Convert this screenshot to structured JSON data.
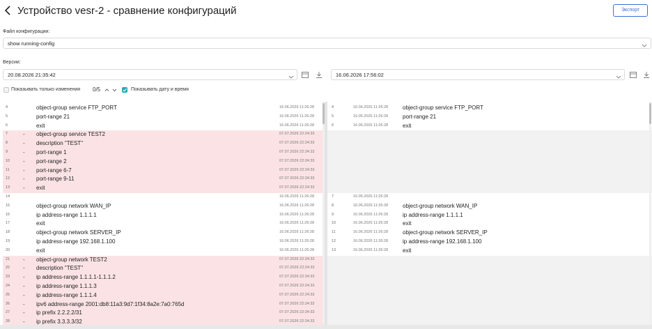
{
  "header": {
    "title": "Устройство vesr-2 - сравнение конфигураций",
    "export_label": "Экспорт"
  },
  "config_file": {
    "label": "Файл конфигурации:",
    "selected": "show running-config"
  },
  "versions": {
    "label": "Версии:",
    "left_selected": "20.08.2026 21:35:42",
    "right_selected": "16.06.2026 17:56:02"
  },
  "options": {
    "only_changes_label": "Показывать только изменения",
    "only_changes_checked": false,
    "changes_counter": "0/5",
    "show_datetime_label": "Показывать дату и время",
    "show_datetime_checked": true
  },
  "colors": {
    "accent": "#2aa6b6",
    "removed_bg": "#fbe3e5",
    "gap_bg": "#f2f2f2",
    "link": "#3b6fd6"
  },
  "left_rows": [
    {
      "ln": "4",
      "mark": "",
      "code": "object-group service FTP_PORT",
      "ts": "16.06.2026 11:26:28",
      "type": "normal"
    },
    {
      "ln": "5",
      "mark": "",
      "code": "port-range 21",
      "ts": "16.06.2026 11:26:28",
      "type": "normal"
    },
    {
      "ln": "6",
      "mark": "",
      "code": "exit",
      "ts": "16.06.2026 11:26:28",
      "type": "normal"
    },
    {
      "ln": "7",
      "mark": "-",
      "code": "object-group service TEST2",
      "ts": "07.07.2026 22:24:33",
      "type": "removed"
    },
    {
      "ln": "8",
      "mark": "-",
      "code": "description \"TEST\"",
      "ts": "07.07.2026 22:24:33",
      "type": "removed"
    },
    {
      "ln": "9",
      "mark": "-",
      "code": "port-range 1",
      "ts": "07.07.2026 22:24:33",
      "type": "removed"
    },
    {
      "ln": "10",
      "mark": "-",
      "code": "port-range 2",
      "ts": "07.07.2026 22:24:33",
      "type": "removed"
    },
    {
      "ln": "11",
      "mark": "-",
      "code": "port-range 6-7",
      "ts": "07.07.2026 22:24:33",
      "type": "removed"
    },
    {
      "ln": "12",
      "mark": "-",
      "code": "port-range 9-11",
      "ts": "07.07.2026 22:24:33",
      "type": "removed"
    },
    {
      "ln": "13",
      "mark": "-",
      "code": "exit",
      "ts": "07.07.2026 22:24:33",
      "type": "removed"
    },
    {
      "ln": "14",
      "mark": "",
      "code": "",
      "ts": "16.06.2026 11:26:28",
      "type": "normal"
    },
    {
      "ln": "15",
      "mark": "",
      "code": "object-group network WAN_IP",
      "ts": "16.06.2026 11:26:28",
      "type": "normal"
    },
    {
      "ln": "16",
      "mark": "",
      "code": "ip address-range 1.1.1.1",
      "ts": "16.06.2026 11:26:28",
      "type": "normal"
    },
    {
      "ln": "17",
      "mark": "",
      "code": "exit",
      "ts": "16.06.2026 11:26:28",
      "type": "normal"
    },
    {
      "ln": "18",
      "mark": "",
      "code": "object-group network SERVER_IP",
      "ts": "16.06.2026 11:26:28",
      "type": "normal"
    },
    {
      "ln": "19",
      "mark": "",
      "code": "ip address-range 192.168.1.100",
      "ts": "16.06.2026 11:26:28",
      "type": "normal"
    },
    {
      "ln": "20",
      "mark": "",
      "code": "exit",
      "ts": "16.06.2026 11:26:28",
      "type": "normal"
    },
    {
      "ln": "21",
      "mark": "-",
      "code": "object-group network TEST2",
      "ts": "07.07.2026 22:24:33",
      "type": "removed"
    },
    {
      "ln": "22",
      "mark": "-",
      "code": "description \"TEST\"",
      "ts": "07.07.2026 22:24:33",
      "type": "removed"
    },
    {
      "ln": "23",
      "mark": "-",
      "code": "ip address-range 1.1.1.1-1.1.1.2",
      "ts": "07.07.2026 22:24:33",
      "type": "removed"
    },
    {
      "ln": "24",
      "mark": "-",
      "code": "ip address-range 1.1.1.3",
      "ts": "07.07.2026 22:24:33",
      "type": "removed"
    },
    {
      "ln": "25",
      "mark": "-",
      "code": "ip address-range 1.1.1.4",
      "ts": "07.07.2026 22:24:33",
      "type": "removed"
    },
    {
      "ln": "26",
      "mark": "-",
      "code": "ipv6 address-range 2001:db8:11a3:9d7:1f34:8a2e:7a0:765d",
      "ts": "07.07.2026 22:24:33",
      "type": "removed"
    },
    {
      "ln": "27",
      "mark": "-",
      "code": "ip prefix 2.2.2.2/31",
      "ts": "07.07.2026 22:24:33",
      "type": "removed"
    },
    {
      "ln": "28",
      "mark": "-",
      "code": "ip prefix 3.3.3.3/32",
      "ts": "07.07.2026 22:24:33",
      "type": "removed"
    }
  ],
  "right_rows": [
    {
      "ln": "4",
      "code": "object-group service FTP_PORT",
      "ts": "16.06.2026 11:26:28",
      "type": "normal"
    },
    {
      "ln": "5",
      "code": "port-range 21",
      "ts": "16.06.2026 11:26:28",
      "type": "normal"
    },
    {
      "ln": "6",
      "code": "exit",
      "ts": "16.06.2026 11:26:28",
      "type": "normal"
    },
    {
      "ln": "",
      "code": "",
      "ts": "",
      "type": "gap"
    },
    {
      "ln": "",
      "code": "",
      "ts": "",
      "type": "gap"
    },
    {
      "ln": "",
      "code": "",
      "ts": "",
      "type": "gap"
    },
    {
      "ln": "",
      "code": "",
      "ts": "",
      "type": "gap"
    },
    {
      "ln": "",
      "code": "",
      "ts": "",
      "type": "gap"
    },
    {
      "ln": "",
      "code": "",
      "ts": "",
      "type": "gap"
    },
    {
      "ln": "",
      "code": "",
      "ts": "",
      "type": "gap"
    },
    {
      "ln": "7",
      "code": "",
      "ts": "16.06.2026 11:26:28",
      "type": "normal"
    },
    {
      "ln": "8",
      "code": "object-group network WAN_IP",
      "ts": "16.06.2026 11:26:28",
      "type": "normal"
    },
    {
      "ln": "9",
      "code": "ip address-range 1.1.1.1",
      "ts": "16.06.2026 11:26:28",
      "type": "normal"
    },
    {
      "ln": "10",
      "code": "exit",
      "ts": "16.06.2026 11:26:28",
      "type": "normal"
    },
    {
      "ln": "11",
      "code": "object-group network SERVER_IP",
      "ts": "16.06.2026 11:26:28",
      "type": "normal"
    },
    {
      "ln": "12",
      "code": "ip address-range 192.168.1.100",
      "ts": "16.06.2026 11:26:28",
      "type": "normal"
    },
    {
      "ln": "13",
      "code": "exit",
      "ts": "16.06.2026 11:26:28",
      "type": "normal"
    },
    {
      "ln": "",
      "code": "",
      "ts": "",
      "type": "gap"
    },
    {
      "ln": "",
      "code": "",
      "ts": "",
      "type": "gap"
    },
    {
      "ln": "",
      "code": "",
      "ts": "",
      "type": "gap"
    },
    {
      "ln": "",
      "code": "",
      "ts": "",
      "type": "gap"
    },
    {
      "ln": "",
      "code": "",
      "ts": "",
      "type": "gap"
    },
    {
      "ln": "",
      "code": "",
      "ts": "",
      "type": "gap"
    },
    {
      "ln": "",
      "code": "",
      "ts": "",
      "type": "gap"
    },
    {
      "ln": "",
      "code": "",
      "ts": "",
      "type": "gap"
    }
  ]
}
